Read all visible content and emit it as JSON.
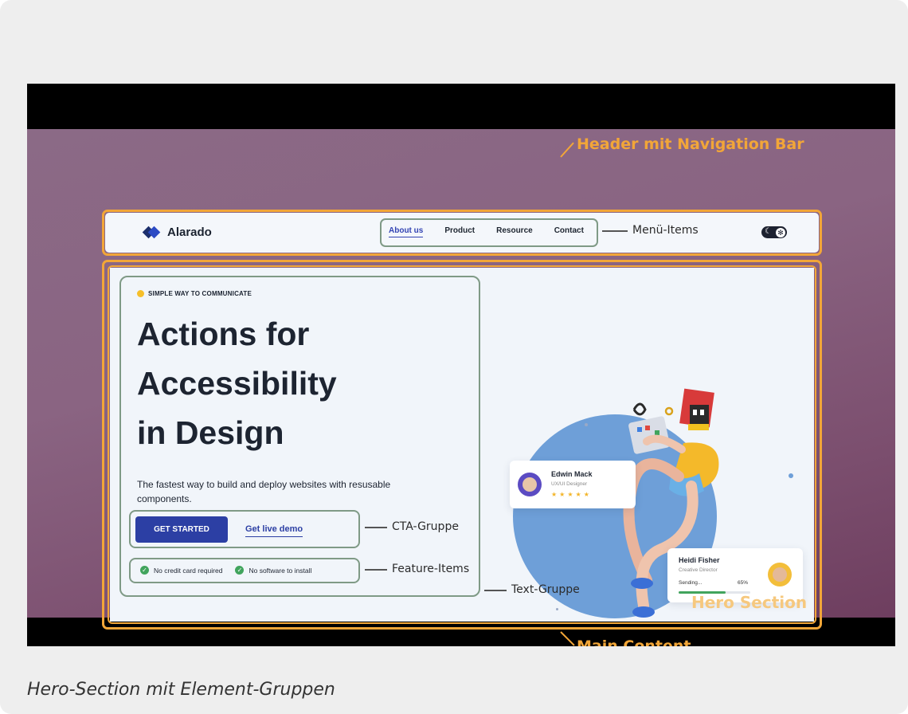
{
  "annotations": {
    "header": "Header mit Navigation Bar",
    "menu_items": "Menü-Items",
    "cta_group": "CTA-Gruppe",
    "feature_items": "Feature-Items",
    "text_group": "Text-Gruppe",
    "hero_section": "Hero Section",
    "main_content": "Main Content"
  },
  "header": {
    "logo": "Alarado",
    "nav": [
      "About us",
      "Product",
      "Resource",
      "Contact"
    ],
    "active_nav": "About us"
  },
  "hero": {
    "eyebrow": "SIMPLE WAY TO COMMUNICATE",
    "headline_lines": [
      "Actions for",
      "Accessibility",
      "in Design"
    ],
    "subtitle": "The fastest way to build and deploy websites with resusable components.",
    "cta_primary": "GET STARTED",
    "cta_secondary": "Get live demo",
    "features": [
      "No credit card required",
      "No software to install"
    ]
  },
  "cards": {
    "edwin": {
      "name": "Edwin Mack",
      "role": "UX/UI Designer",
      "stars": "★★★★★"
    },
    "heidi": {
      "name": "Heidi Fisher",
      "role": "Creative Director",
      "status": "Sending...",
      "percent_label": "65%",
      "progress": 0.65
    }
  },
  "caption": "Hero-Section mit Element-Gruppen",
  "colors": {
    "annotation_orange": "#f2a638",
    "group_green": "#7f9a86",
    "primary_blue": "#2c3fa4",
    "check_green": "#41a45d"
  }
}
